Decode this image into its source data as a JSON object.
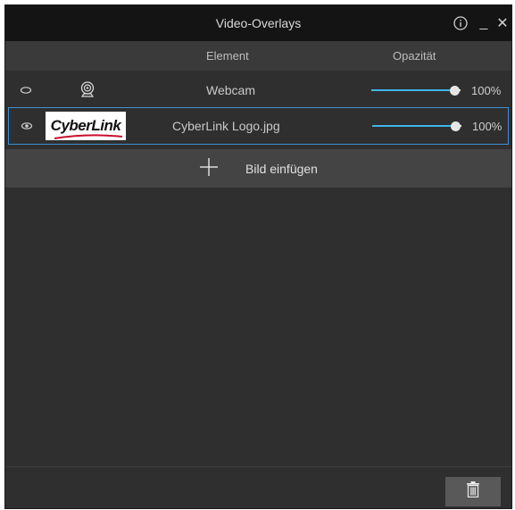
{
  "window": {
    "title": "Video-Overlays",
    "info_icon": "info-icon",
    "minimize_label": "_",
    "close_label": "✕"
  },
  "columns": {
    "element": "Element",
    "opacity": "Opazität"
  },
  "overlays": [
    {
      "visible": true,
      "icon": "webcam-icon",
      "name": "Webcam",
      "opacity_percent": 100,
      "opacity_label": "100%",
      "selected": false
    },
    {
      "visible": true,
      "icon": "cyberlink-logo-thumbnail",
      "logo_text": "CyberLink",
      "name": "CyberLink Logo.jpg",
      "opacity_percent": 100,
      "opacity_label": "100%",
      "selected": true
    }
  ],
  "add_image": {
    "label": "Bild einfügen",
    "icon": "plus-icon"
  },
  "footer": {
    "delete_icon": "trash-icon"
  },
  "colors": {
    "accent": "#3fb6e8",
    "selection_border": "#3e90d6",
    "background": "#2f2f2f",
    "titlebar": "#141414"
  }
}
